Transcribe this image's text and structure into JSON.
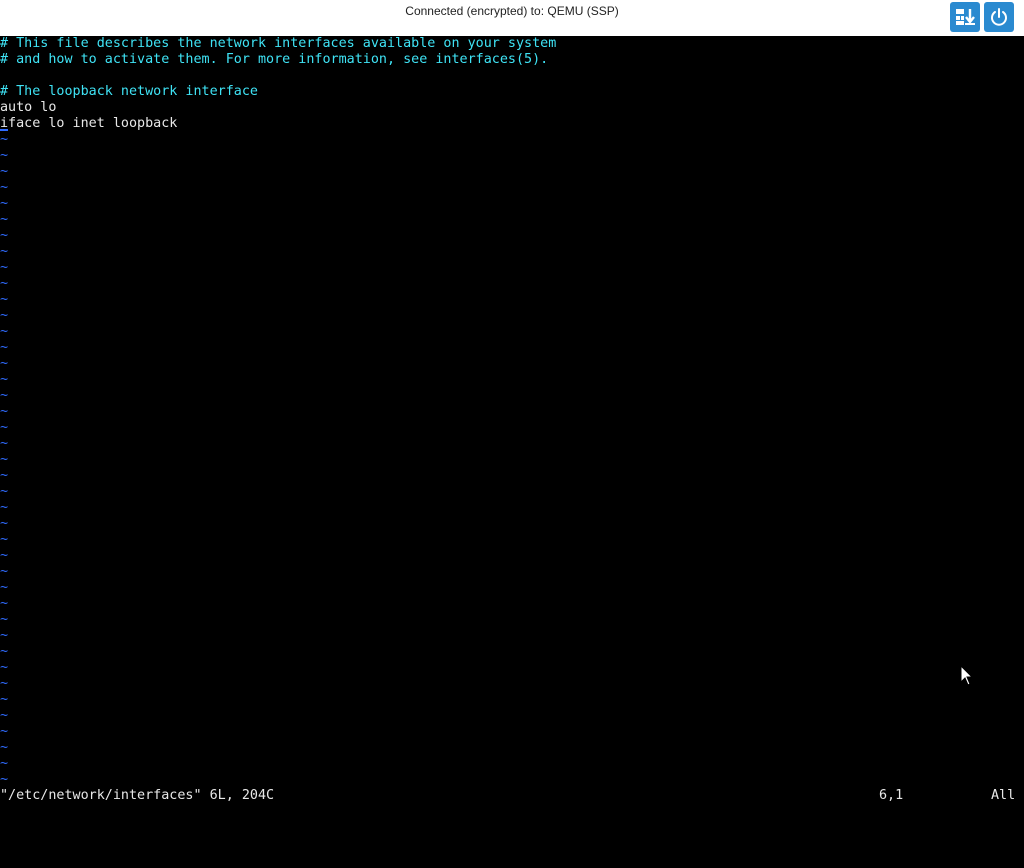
{
  "toolbar": {
    "connection_status": "Connected (encrypted) to: QEMU (SSP)",
    "send_keys_icon": "send-keys-icon",
    "power_icon": "power-icon",
    "accent_color": "#2a8ad0"
  },
  "editor": {
    "lines": [
      {
        "text": "# This file describes the network interfaces available on your system",
        "kind": "comment"
      },
      {
        "text": "# and how to activate them. For more information, see interfaces(5).",
        "kind": "comment"
      },
      {
        "text": "",
        "kind": "blank"
      },
      {
        "text": "# The loopback network interface",
        "kind": "comment"
      },
      {
        "text": "auto lo",
        "kind": "plain"
      },
      {
        "text": "iface lo inet loopback",
        "kind": "plain"
      }
    ],
    "empty_line_marker": "~",
    "colors": {
      "comment": "#3fe3f5",
      "text": "#e8e8e8",
      "tilde": "#2f6bff",
      "background": "#000000"
    }
  },
  "status_line": {
    "file_info": "\"/etc/network/interfaces\" 6L, 204C",
    "cursor_position": "6,1",
    "scroll_position": "All"
  }
}
